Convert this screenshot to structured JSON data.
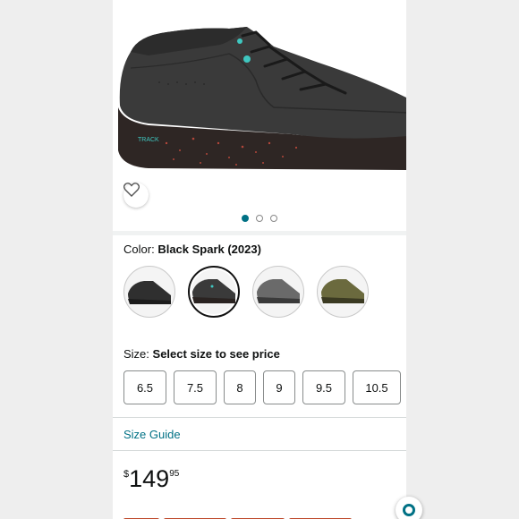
{
  "product": {
    "color_label": "Color:",
    "color_value": "Black Spark (2023)",
    "image_dots": 3,
    "active_dot": 1
  },
  "swatches": [
    {
      "name": "swatch-black-shoe",
      "selected": false
    },
    {
      "name": "swatch-black-spark",
      "selected": true
    },
    {
      "name": "swatch-grey-shoe",
      "selected": false
    },
    {
      "name": "swatch-olive-shoe",
      "selected": false
    }
  ],
  "size": {
    "label": "Size:",
    "prompt": "Select size to see price",
    "options": [
      "6.5",
      "7.5",
      "8",
      "9",
      "9.5",
      "10.5"
    ]
  },
  "size_guide": "Size Guide",
  "price": {
    "currency": "$",
    "whole": "149",
    "fraction": "95"
  },
  "icons": {
    "favorite": "heart-icon",
    "fab": "assistant-icon"
  },
  "colors": {
    "link": "#007185",
    "text": "#0f1111",
    "selected_border": "#111111"
  }
}
